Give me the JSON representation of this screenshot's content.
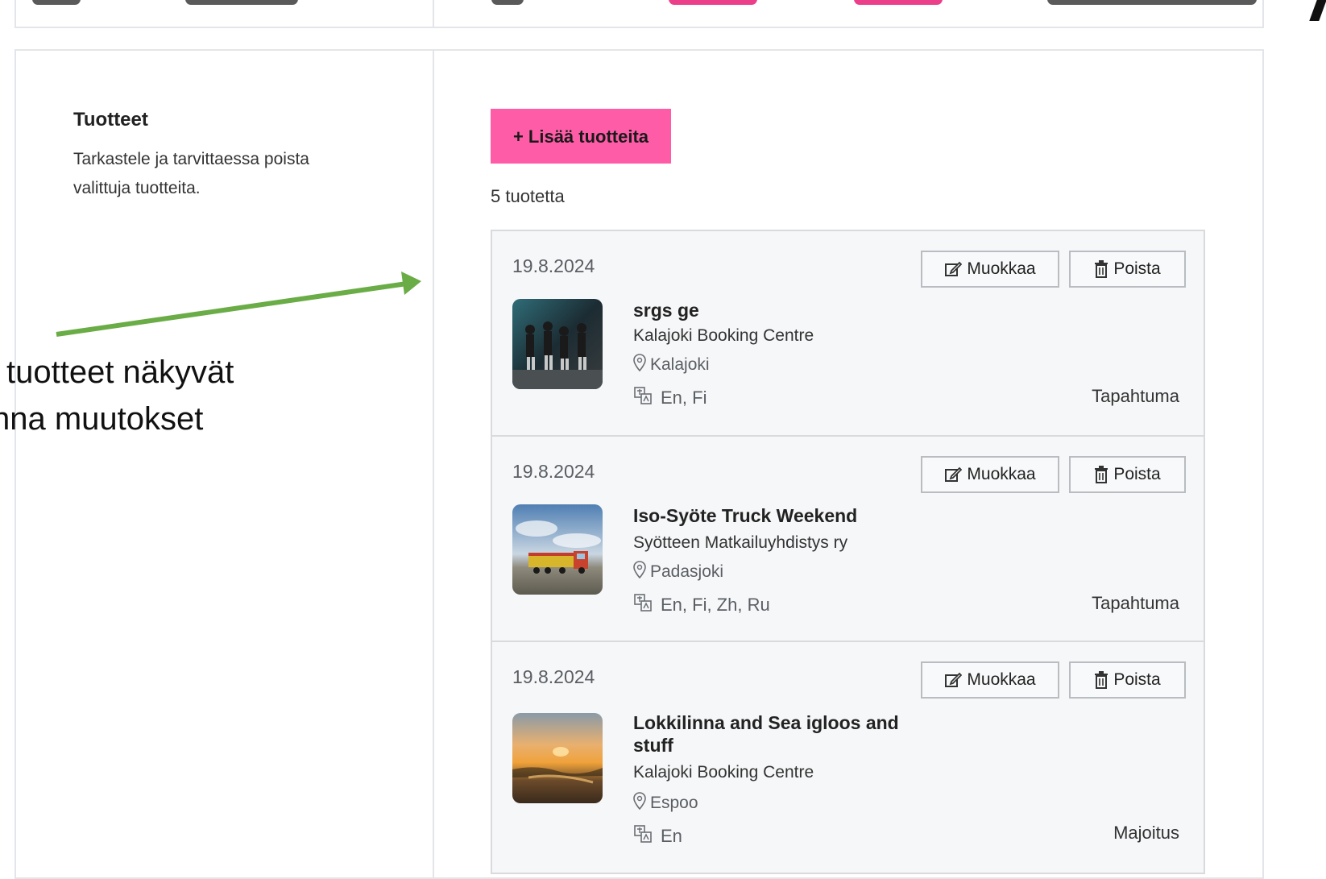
{
  "sidebar": {
    "title": "Tuotteet",
    "description": "Tarkastele ja tarvittaessa poista valittuja tuotteita."
  },
  "main": {
    "add_button": "+ Lisää tuotteita",
    "count": "5 tuotetta"
  },
  "products": [
    {
      "date": "19.8.2024",
      "edit_label": "Muokkaa",
      "delete_label": "Poista",
      "name": "srgs ge",
      "organization": "Kalajoki Booking Centre",
      "location": "Kalajoki",
      "languages": "En, Fi",
      "type": "Tapahtuma"
    },
    {
      "date": "19.8.2024",
      "edit_label": "Muokkaa",
      "delete_label": "Poista",
      "name": "Iso-Syöte Truck Weekend",
      "organization": "Syötteen Matkailuyhdistys ry",
      "location": "Padasjoki",
      "languages": "En, Fi, Zh, Ru",
      "type": "Tapahtuma"
    },
    {
      "date": "19.8.2024",
      "edit_label": "Muokkaa",
      "delete_label": "Poista",
      "name": "Lokkilinna and Sea igloos and stuff",
      "organization": "Kalajoki Booking Centre",
      "location": "Espoo",
      "languages": "En",
      "type": "Majoitus"
    }
  ],
  "annotation": {
    "line1": "tuotteet näkyvät",
    "line2": "nna muutokset"
  },
  "colors": {
    "accent_pink": "#ff5ca8",
    "arrow_green": "#6aac46",
    "card_border": "#e3e5e8"
  }
}
